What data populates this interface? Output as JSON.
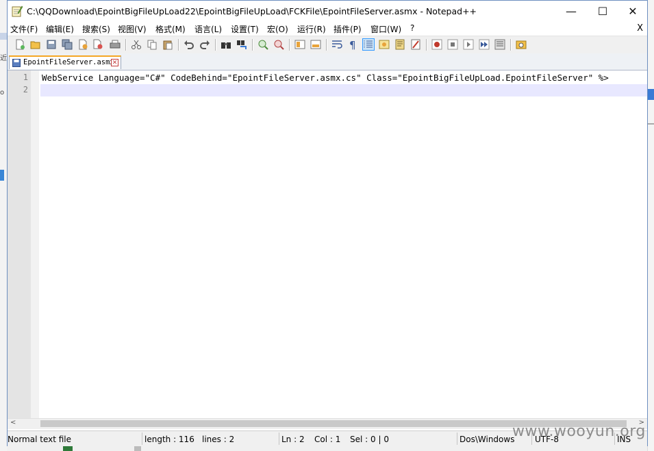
{
  "window": {
    "title": "C:\\QQDownload\\EpointBigFileUpLoad22\\EpointBigFileUpLoad\\FCKFile\\EpointFileServer.asmx - Notepad++",
    "minimize_glyph": "—",
    "maximize_glyph": "☐",
    "close_glyph": "✕"
  },
  "menu": {
    "items": [
      "文件(F)",
      "编辑(E)",
      "搜索(S)",
      "视图(V)",
      "格式(M)",
      "语言(L)",
      "设置(T)",
      "宏(O)",
      "运行(R)",
      "插件(P)",
      "窗口(W)",
      "?"
    ],
    "close_label": "X"
  },
  "toolbar": {
    "buttons": [
      "new-file",
      "open-file",
      "save",
      "save-all",
      "close",
      "close-all",
      "print",
      "cut",
      "copy",
      "paste",
      "undo",
      "redo",
      "find",
      "replace",
      "zoom-in",
      "zoom-out",
      "sync-vertical",
      "sync-horizontal",
      "word-wrap",
      "show-all-chars",
      "indent-guide",
      "user-defined-language",
      "document-map",
      "function-list",
      "record-macro",
      "stop-recording",
      "playback-macro",
      "run-macro-multiple",
      "save-macro",
      "launch-in-browser"
    ],
    "active": "indent-guide"
  },
  "tabs": [
    {
      "label": "EpointFileServer.asmx",
      "active": true
    }
  ],
  "editor": {
    "line_numbers": [
      "1",
      "2"
    ],
    "lines": [
      "WebService Language=\"C#\" CodeBehind=\"EpointFileServer.asmx.cs\" Class=\"EpointBigFileUpLoad.EpointFileServer\" %>",
      ""
    ],
    "current_line": 2,
    "current_line_color": "#e8e8ff"
  },
  "scrollbar": {
    "left_arrow": "<",
    "right_arrow": ">"
  },
  "status": {
    "file_type": "Normal text file",
    "length": "length : 116",
    "lines": "lines : 2",
    "ln": "Ln : 2",
    "col": "Col : 1",
    "sel": "Sel : 0 | 0",
    "eol": "Dos\\Windows",
    "encoding": "UTF-8",
    "mode": "INS"
  },
  "watermark": "www.wooyun.org",
  "colors": {
    "accent_tab": "#f5a623",
    "line_number": "#808080",
    "gutter_bg": "#e4e4e4"
  }
}
